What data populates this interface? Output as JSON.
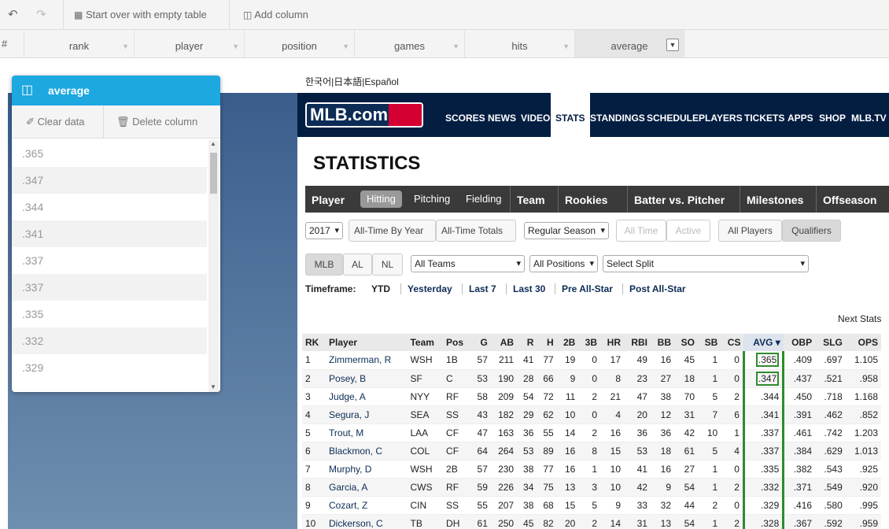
{
  "toolbar": {
    "undo_icon": "undo-icon",
    "redo_icon": "redo-icon",
    "start_over_label": "Start over with empty table",
    "add_column_label": "Add column"
  },
  "columns": {
    "row_marker": "#",
    "headers": [
      "rank",
      "player",
      "position",
      "games",
      "hits",
      "average"
    ]
  },
  "panel": {
    "title": "average",
    "clear_label": "Clear data",
    "delete_label": "Delete column",
    "values": [
      ".365",
      ".347",
      ".344",
      ".341",
      ".337",
      ".337",
      ".335",
      ".332",
      ".329"
    ]
  },
  "site": {
    "languages": [
      "한국어",
      "日本語",
      "Español"
    ],
    "logo": "MLB.com",
    "nav": [
      "SCORES",
      "NEWS",
      "VIDEO",
      "STATS",
      "STANDINGS",
      "SCHEDULE",
      "PLAYERS",
      "TICKETS",
      "APPS",
      "SHOP",
      "MLB.TV"
    ],
    "active_nav": "STATS",
    "page_title": "STATISTICS",
    "tabs": {
      "player": "Player",
      "sub": [
        "Hitting",
        "Pitching",
        "Fielding"
      ],
      "others": [
        "Team",
        "Rookies",
        "Batter vs. Pitcher",
        "Milestones",
        "Offseason Le"
      ]
    },
    "filters": {
      "year": "2017",
      "all_time_by_year": "All-Time By Year",
      "all_time_totals": "All-Time Totals",
      "season": "Regular Season",
      "all_time": "All Time",
      "active": "Active",
      "all_players": "All Players",
      "qualifiers": "Qualifiers",
      "leagues": [
        "MLB",
        "AL",
        "NL"
      ],
      "teams": "All Teams",
      "positions": "All Positions",
      "split": "Select Split"
    },
    "timeframe": {
      "label": "Timeframe:",
      "options": [
        "YTD",
        "Yesterday",
        "Last 7",
        "Last 30",
        "Pre All-Star",
        "Post All-Star"
      ]
    },
    "next_stats": "Next Stats",
    "table": {
      "headers": [
        "RK",
        "Player",
        "Team",
        "Pos",
        "G",
        "AB",
        "R",
        "H",
        "2B",
        "3B",
        "HR",
        "RBI",
        "BB",
        "SO",
        "SB",
        "CS",
        "AVG ▾",
        "OBP",
        "SLG",
        "OPS"
      ],
      "rows": [
        [
          "1",
          "Zimmerman, R",
          "WSH",
          "1B",
          "57",
          "211",
          "41",
          "77",
          "19",
          "0",
          "17",
          "49",
          "16",
          "45",
          "1",
          "0",
          ".365",
          ".409",
          ".697",
          "1.105"
        ],
        [
          "2",
          "Posey, B",
          "SF",
          "C",
          "53",
          "190",
          "28",
          "66",
          "9",
          "0",
          "8",
          "23",
          "27",
          "18",
          "1",
          "0",
          ".347",
          ".437",
          ".521",
          ".958"
        ],
        [
          "3",
          "Judge, A",
          "NYY",
          "RF",
          "58",
          "209",
          "54",
          "72",
          "11",
          "2",
          "21",
          "47",
          "38",
          "70",
          "5",
          "2",
          ".344",
          ".450",
          ".718",
          "1.168"
        ],
        [
          "4",
          "Segura, J",
          "SEA",
          "SS",
          "43",
          "182",
          "29",
          "62",
          "10",
          "0",
          "4",
          "20",
          "12",
          "31",
          "7",
          "6",
          ".341",
          ".391",
          ".462",
          ".852"
        ],
        [
          "5",
          "Trout, M",
          "LAA",
          "CF",
          "47",
          "163",
          "36",
          "55",
          "14",
          "2",
          "16",
          "36",
          "36",
          "42",
          "10",
          "1",
          ".337",
          ".461",
          ".742",
          "1.203"
        ],
        [
          "6",
          "Blackmon, C",
          "COL",
          "CF",
          "64",
          "264",
          "53",
          "89",
          "16",
          "8",
          "15",
          "53",
          "18",
          "61",
          "5",
          "4",
          ".337",
          ".384",
          ".629",
          "1.013"
        ],
        [
          "7",
          "Murphy, D",
          "WSH",
          "2B",
          "57",
          "230",
          "38",
          "77",
          "16",
          "1",
          "10",
          "41",
          "16",
          "27",
          "1",
          "0",
          ".335",
          ".382",
          ".543",
          ".925"
        ],
        [
          "8",
          "Garcia, A",
          "CWS",
          "RF",
          "59",
          "226",
          "34",
          "75",
          "13",
          "3",
          "10",
          "42",
          "9",
          "54",
          "1",
          "2",
          ".332",
          ".371",
          ".549",
          ".920"
        ],
        [
          "9",
          "Cozart, Z",
          "CIN",
          "SS",
          "55",
          "207",
          "38",
          "68",
          "15",
          "5",
          "9",
          "33",
          "32",
          "44",
          "2",
          "0",
          ".329",
          ".416",
          ".580",
          ".995"
        ],
        [
          "10",
          "Dickerson, C",
          "TB",
          "DH",
          "61",
          "250",
          "45",
          "82",
          "20",
          "2",
          "14",
          "31",
          "13",
          "54",
          "1",
          "2",
          ".328",
          ".367",
          ".592",
          ".959"
        ]
      ]
    }
  },
  "colors": {
    "accent": "#1da8e0",
    "mlb_navy": "#041e42",
    "highlight": "#2e8b2e"
  }
}
